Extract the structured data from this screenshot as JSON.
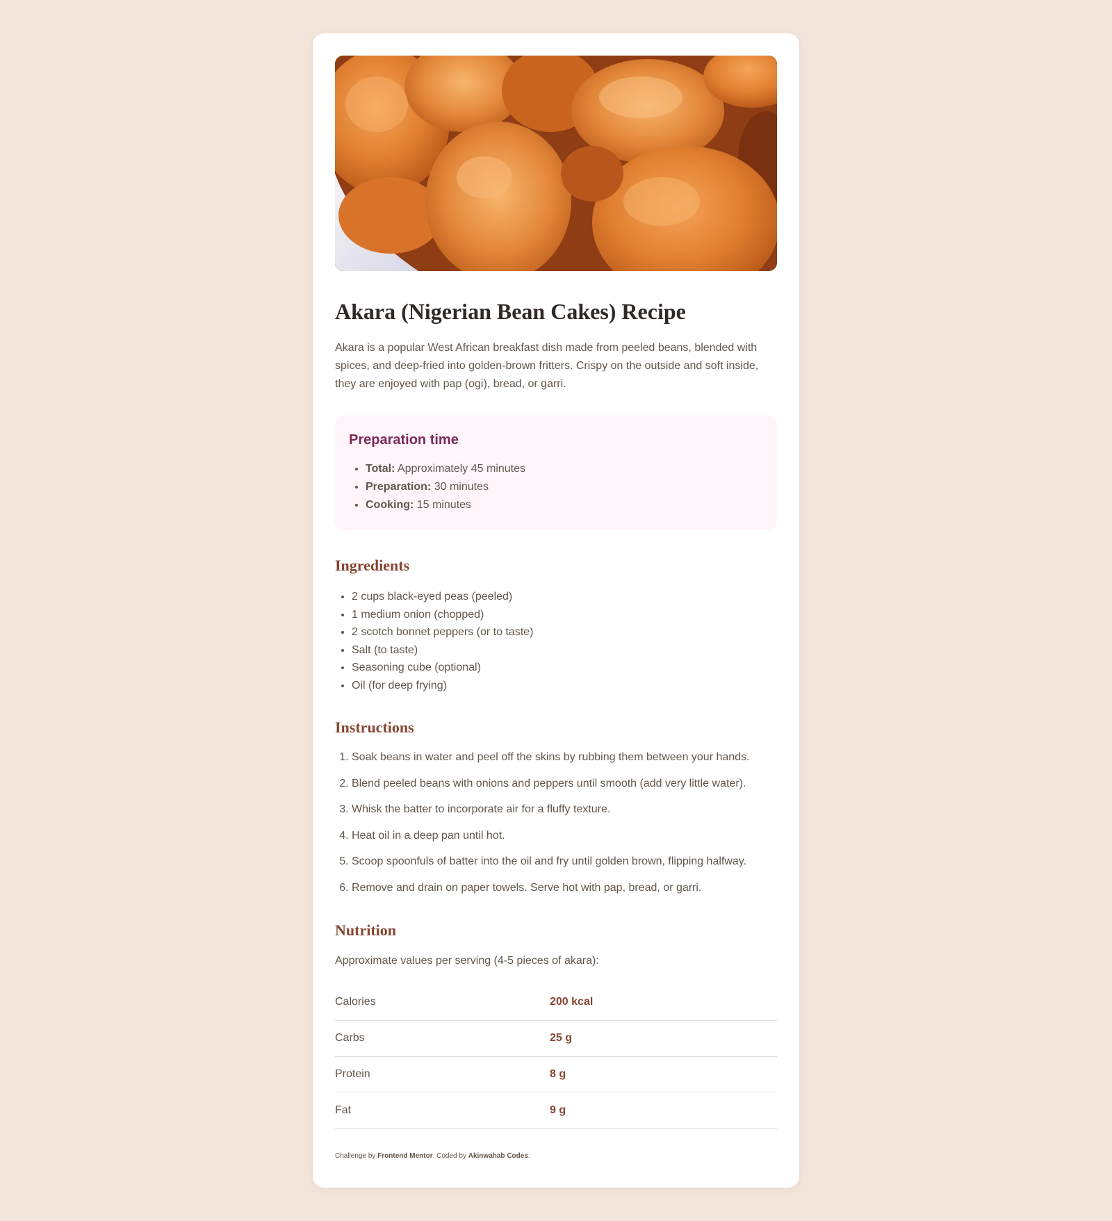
{
  "hero": {
    "alt": "Akara fritters"
  },
  "title": "Akara (Nigerian Bean Cakes) Recipe",
  "intro": "Akara is a popular West African breakfast dish made from peeled beans, blended with spices, and deep-fried into golden-brown fritters. Crispy on the outside and soft inside, they are enjoyed with pap (ogi), bread, or garri.",
  "preparation": {
    "heading": "Preparation time",
    "items": [
      {
        "label": "Total:",
        "value": " Approximately 45 minutes"
      },
      {
        "label": "Preparation:",
        "value": " 30 minutes"
      },
      {
        "label": "Cooking:",
        "value": " 15 minutes"
      }
    ]
  },
  "ingredients": {
    "heading": "Ingredients",
    "items": [
      "2 cups black-eyed peas (peeled)",
      "1 medium onion (chopped)",
      "2 scotch bonnet peppers (or to taste)",
      "Salt (to taste)",
      "Seasoning cube (optional)",
      "Oil (for deep frying)"
    ]
  },
  "instructions": {
    "heading": "Instructions",
    "steps": [
      "Soak beans in water and peel off the skins by rubbing them between your hands.",
      "Blend peeled beans with onions and peppers until smooth (add very little water).",
      "Whisk the batter to incorporate air for a fluffy texture.",
      "Heat oil in a deep pan until hot.",
      "Scoop spoonfuls of batter into the oil and fry until golden brown, flipping halfway.",
      "Remove and drain on paper towels. Serve hot with pap, bread, or garri."
    ]
  },
  "nutrition": {
    "heading": "Nutrition",
    "note": "Approximate values per serving (4-5 pieces of akara):",
    "rows": [
      {
        "label": "Calories",
        "value": "200 kcal"
      },
      {
        "label": "Carbs",
        "value": "25 g"
      },
      {
        "label": "Protein",
        "value": "8 g"
      },
      {
        "label": "Fat",
        "value": "9 g"
      }
    ]
  },
  "footer": {
    "prefix": "Challenge by ",
    "challenge_by": "Frontend Mentor",
    "middle": ". Coded by ",
    "coded_by": "Akinwahab Codes",
    "suffix": "."
  },
  "colors": {
    "page_background": "#f2e5d9",
    "card_background": "#ffffff",
    "heading_brown": "#854632",
    "prep_heading": "#7b2a57",
    "prep_background": "#fff5fa",
    "body_text": "#5f564d"
  }
}
